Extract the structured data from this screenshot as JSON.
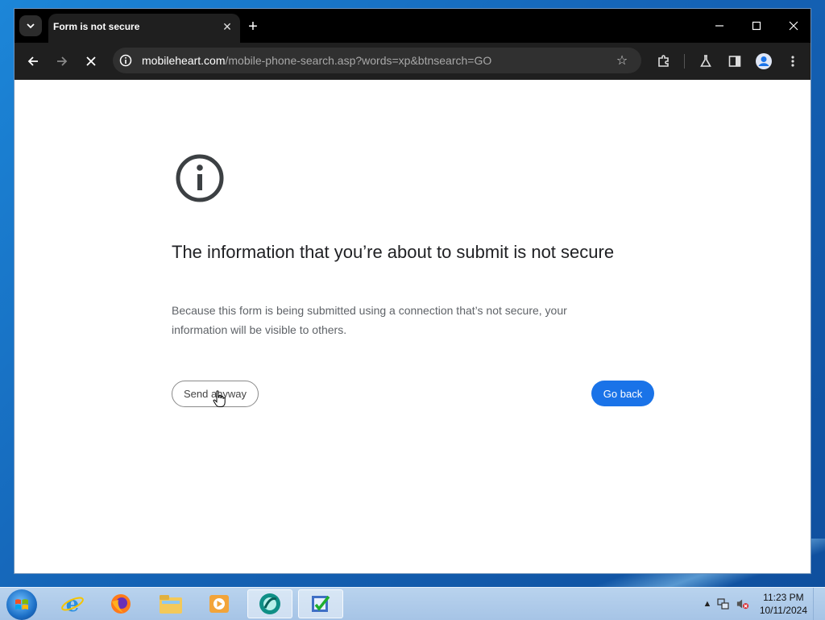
{
  "browser": {
    "tab_title": "Form is not secure",
    "url_host": "mobileheart.com",
    "url_path": "/mobile-phone-search.asp?words=xp&btnsearch=GO"
  },
  "page": {
    "heading": "The information that you’re about to submit is not secure",
    "description": "Because this form is being submitted using a connection that’s not secure, your information will be visible to others.",
    "send_anyway_label": "Send anyway",
    "go_back_label": "Go back"
  },
  "taskbar": {
    "apps": [
      "internet-explorer",
      "firefox",
      "file-explorer",
      "media-player",
      "browser-active",
      "task-app"
    ],
    "clock_time": "11:23 PM",
    "clock_date": "10/11/2024"
  },
  "colors": {
    "primary_button": "#1a73e8",
    "heading_text": "#202124",
    "body_text": "#5f6368"
  }
}
